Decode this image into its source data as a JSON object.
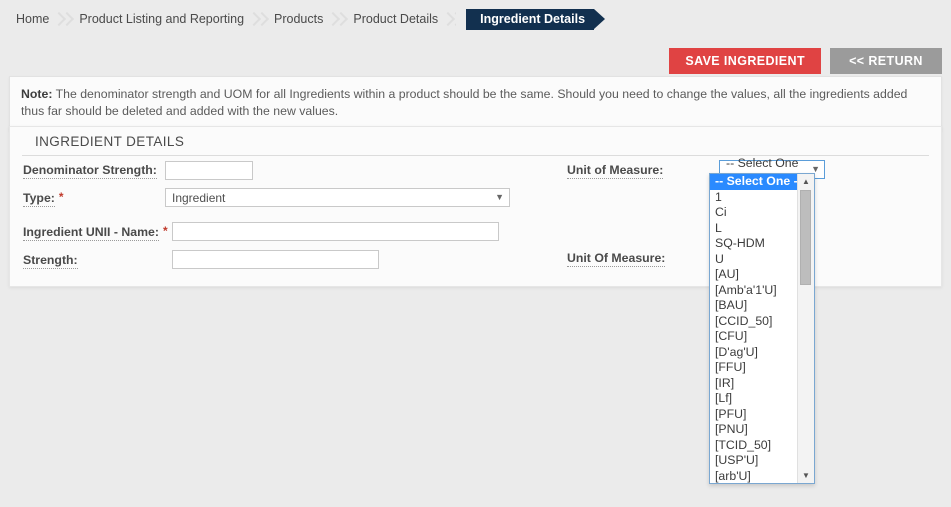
{
  "breadcrumb": {
    "items": [
      {
        "label": "Home",
        "active": false
      },
      {
        "label": "Product Listing and Reporting",
        "active": false
      },
      {
        "label": "Products",
        "active": false
      },
      {
        "label": "Product Details",
        "active": false
      },
      {
        "label": "Ingredient Details",
        "active": true
      }
    ]
  },
  "toolbar": {
    "save_label": "SAVE INGREDIENT",
    "return_label": "<< RETURN",
    "save_color": "#e04343",
    "return_color": "#9b9b9b"
  },
  "note": {
    "label": "Note:",
    "text": " The denominator strength and UOM for all Ingredients within a product should be the same. Should you need to change the values, all the ingredients added thus far should be deleted and added with the new values."
  },
  "panel": {
    "title": "INGREDIENT DETAILS",
    "fields": {
      "denominator_strength": {
        "label": "Denominator Strength:",
        "value": "",
        "required": false
      },
      "type": {
        "label": "Type:",
        "value": "Ingredient",
        "required": true,
        "required_marker": "*"
      },
      "ingredient_unii_name": {
        "label": "Ingredient UNII - Name:",
        "value": "",
        "required": true,
        "required_marker": "*"
      },
      "strength": {
        "label": "Strength:",
        "value": "",
        "required": false
      },
      "unit_of_measure": {
        "label": "Unit of Measure:",
        "value": "-- Select One --",
        "required": false,
        "expanded": true
      },
      "unit_of_measure_2": {
        "label": "Unit Of Measure:",
        "value": "",
        "required": false
      }
    }
  },
  "uom_dropdown": {
    "selected_index": 0,
    "highlight_color": "#2a8aff",
    "options": [
      "-- Select One --",
      "1",
      "Ci",
      "L",
      "SQ-HDM",
      "U",
      "[AU]",
      "[Amb'a'1'U]",
      "[BAU]",
      "[CCID_50]",
      "[CFU]",
      "[D'ag'U]",
      "[FFU]",
      "[IR]",
      "[Lf]",
      "[PFU]",
      "[PNU]",
      "[TCID_50]",
      "[USP'U]",
      "[arb'U]"
    ],
    "scroll_up_icon": "▲",
    "scroll_down_icon": "▼"
  },
  "icons": {
    "caret_down": "▼",
    "breadcrumb_chevron": "chevron-right-icon"
  }
}
